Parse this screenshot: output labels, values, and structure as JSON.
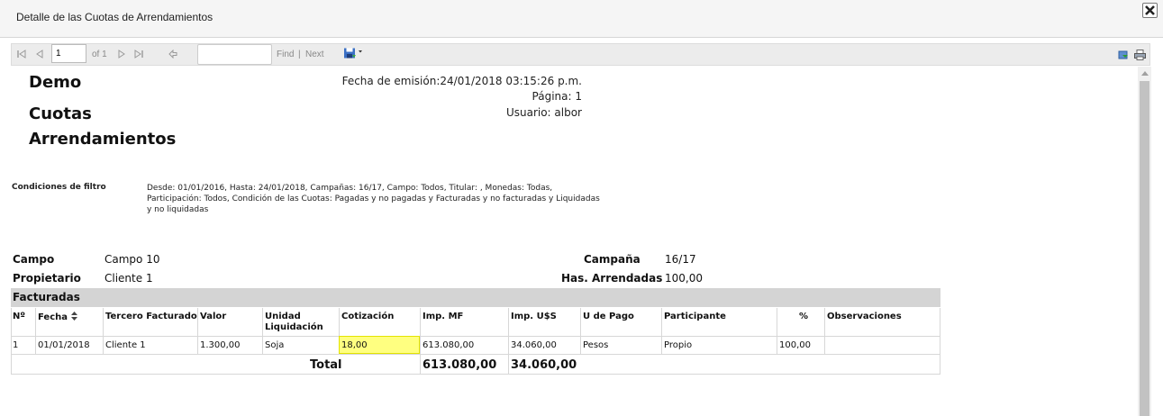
{
  "dialog": {
    "title": "Detalle de las Cuotas de Arrendamientos"
  },
  "toolbar": {
    "page_value": "1",
    "of_label": "of 1",
    "find_label": "Find",
    "separator": "|",
    "next_label": "Next"
  },
  "report": {
    "company": "Demo",
    "title_line1": "Cuotas",
    "title_line2": "Arrendamientos",
    "emission": "Fecha de emisión:24/01/2018 03:15:26 p.m.",
    "page": "Página: 1",
    "user": "Usuario: albor",
    "filter_label": "Condiciones de filtro",
    "filter_text": "Desde: 01/01/2016, Hasta: 24/01/2018, Campañas: 16/17, Campo: Todos, Titular: , Monedas: Todas, Participación: Todos, Condición de las Cuotas: Pagadas y no pagadas y Facturadas y no facturadas y Liquidadas y no liquidadas",
    "campo_label": "Campo",
    "campo_value": "Campo 10",
    "propietario_label": "Propietario",
    "propietario_value": "Cliente 1",
    "campana_label": "Campaña",
    "campana_value": "16/17",
    "has_label": "Has. Arrendadas",
    "has_value": "100,00",
    "section": "Facturadas",
    "headers": [
      "Nº",
      "Fecha",
      "Tercero Facturado",
      "Valor",
      "Unidad Liquidación",
      "Cotización",
      "Imp. MF",
      "Imp. U$S",
      "U de Pago",
      "Participante",
      "%",
      "Observaciones"
    ],
    "rows": [
      [
        "1",
        "01/01/2018",
        "Cliente 1",
        "1.300,00",
        "Soja",
        "18,00",
        "613.080,00",
        "34.060,00",
        "Pesos",
        "Propio",
        "100,00",
        ""
      ]
    ],
    "total_label": "Total",
    "total_mf": "613.080,00",
    "total_usd": "34.060,00"
  }
}
